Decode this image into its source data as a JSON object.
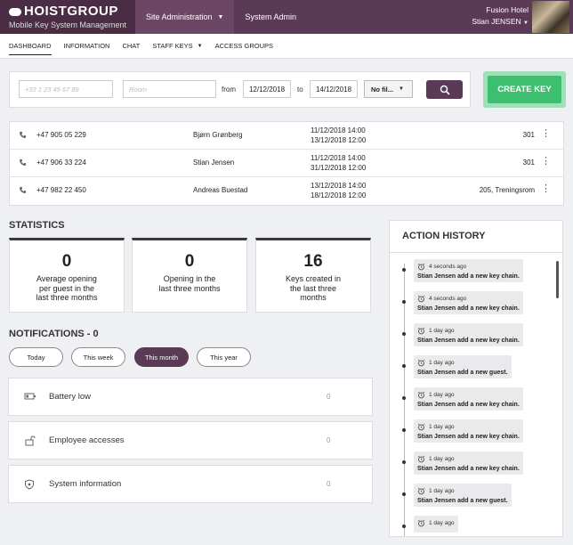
{
  "header": {
    "brand": "HOISTGROUP",
    "subtitle": "Mobile Key System Management",
    "nav": [
      {
        "label": "Site Administration"
      },
      {
        "label": "System Admin"
      }
    ],
    "hotel": "Fusion Hotel",
    "user": "Stian JENSEN"
  },
  "subnav": {
    "tabs": [
      "DASHBOARD",
      "INFORMATION",
      "CHAT",
      "STAFF KEYS",
      "ACCESS GROUPS"
    ]
  },
  "search": {
    "phone_placeholder": "+33 1 23 45 67 89",
    "room_placeholder": "Room",
    "from_label": "from",
    "from_date": "12/12/2018",
    "to_label": "to",
    "to_date": "14/12/2018",
    "filter_value": "No fil...",
    "create_label": "CREATE KEY"
  },
  "keys": [
    {
      "phone": "+47 905 05 229",
      "name": "Bjørn Grønberg",
      "from": "11/12/2018 14:00",
      "to": "13/12/2018 12:00",
      "room": "301"
    },
    {
      "phone": "+47 906 33 224",
      "name": "Stian Jensen",
      "from": "11/12/2018 14:00",
      "to": "31/12/2018 12:00",
      "room": "301"
    },
    {
      "phone": "+47 982 22 450",
      "name": "Andreas Buestad",
      "from": "13/12/2018 14:00",
      "to": "18/12/2018 12:00",
      "room": "205, Treningsrom"
    }
  ],
  "statistics": {
    "title": "STATISTICS",
    "cards": [
      {
        "value": "0",
        "line1": "Average opening",
        "line2": "per guest in the",
        "line3": "last three months"
      },
      {
        "value": "0",
        "line1": "Opening in the",
        "line2": "last three months",
        "line3": ""
      },
      {
        "value": "16",
        "line1": "Keys created in",
        "line2": "the last three",
        "line3": "months"
      }
    ]
  },
  "notifications": {
    "title": "NOTIFICATIONS - 0",
    "filters": [
      "Today",
      "This week",
      "This month",
      "This year"
    ],
    "items": [
      {
        "label": "Battery low",
        "count": "0"
      },
      {
        "label": "Employee accesses",
        "count": "0"
      },
      {
        "label": "System information",
        "count": "0"
      }
    ]
  },
  "history": {
    "title": "ACTION HISTORY",
    "items": [
      {
        "time": "4 seconds ago",
        "text": "Stian Jensen add a new key chain."
      },
      {
        "time": "4 seconds ago",
        "text": "Stian Jensen add a new key chain."
      },
      {
        "time": "1 day ago",
        "text": "Stian Jensen add a new key chain."
      },
      {
        "time": "1 day ago",
        "text": "Stian Jensen add a new guest."
      },
      {
        "time": "1 day ago",
        "text": "Stian Jensen add a new key chain."
      },
      {
        "time": "1 day ago",
        "text": "Stian Jensen add a new key chain."
      },
      {
        "time": "1 day ago",
        "text": "Stian Jensen add a new key chain."
      },
      {
        "time": "1 day ago",
        "text": "Stian Jensen add a new guest."
      },
      {
        "time": "1 day ago",
        "text": ""
      }
    ]
  }
}
